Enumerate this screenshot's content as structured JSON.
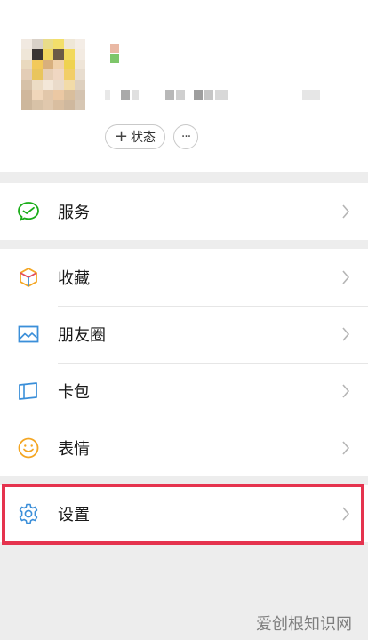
{
  "profile": {
    "status_label": "状态",
    "status_plus": "+",
    "more_label": "···"
  },
  "menu": {
    "services": "服务",
    "favorites": "收藏",
    "moments": "朋友圈",
    "cards": "卡包",
    "stickers": "表情",
    "settings": "设置"
  },
  "colors": {
    "highlight_border": "#e5334e",
    "services_icon": "#1aad19",
    "page_bg": "#ededed"
  },
  "icons": {
    "services": "wechat-pay-icon",
    "favorites": "cube-icon",
    "moments": "image-icon",
    "cards": "card-icon",
    "stickers": "smiley-icon",
    "settings": "gear-icon",
    "chevron": "chevron-right-icon"
  },
  "watermark": "爱创根知识网"
}
